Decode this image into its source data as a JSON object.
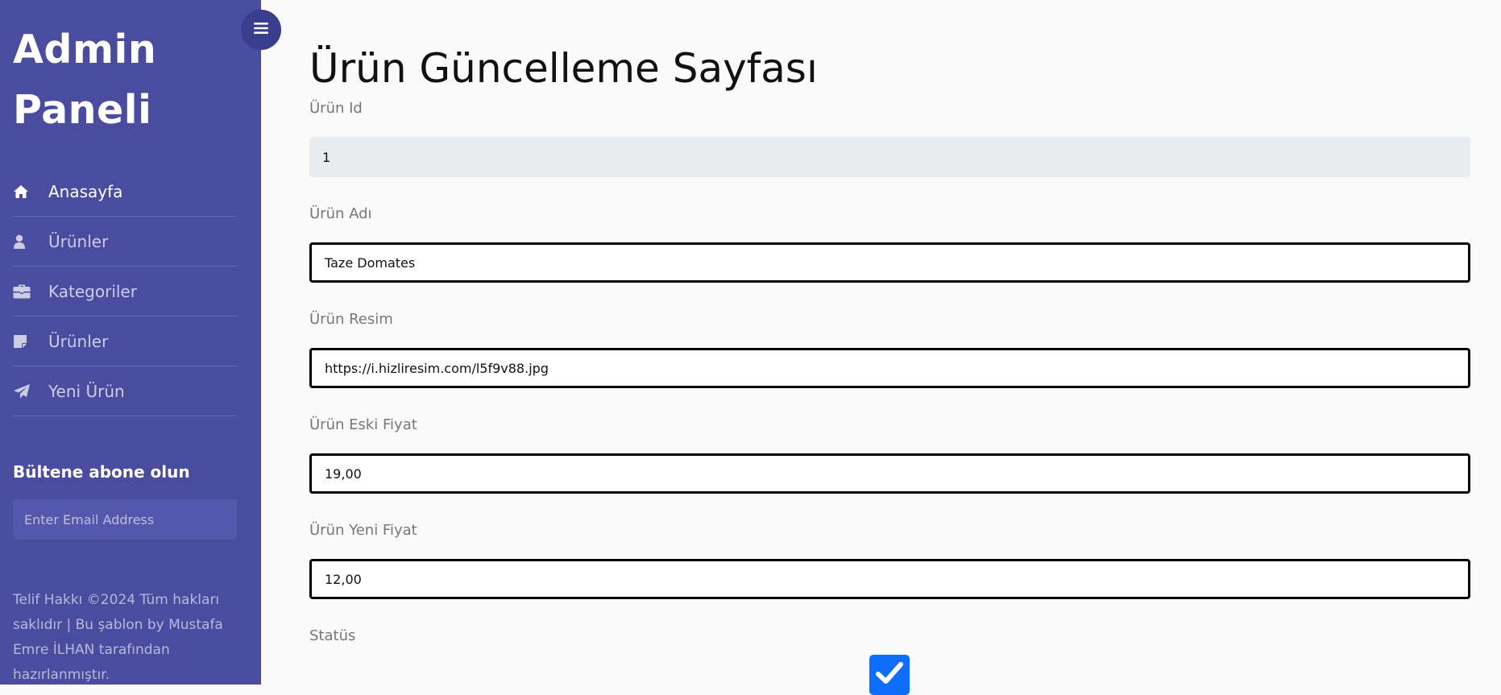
{
  "sidebar": {
    "brand_line1": "Admin",
    "brand_line2": "Paneli",
    "items": [
      {
        "label": "Anasayfa",
        "icon": "home-icon",
        "active": true
      },
      {
        "label": "Ürünler",
        "icon": "user-icon",
        "active": false
      },
      {
        "label": "Kategoriler",
        "icon": "briefcase-icon",
        "active": false
      },
      {
        "label": "Ürünler",
        "icon": "sticky-note-icon",
        "active": false
      },
      {
        "label": "Yeni Ürün",
        "icon": "paper-plane-icon",
        "active": false
      }
    ],
    "newsletter_title": "Bültene abone olun",
    "newsletter_placeholder": "Enter Email Address",
    "copyright": "Telif Hakkı ©2024 Tüm hakları saklıdır | Bu şablon by Mustafa Emre İLHAN tarafından hazırlanmıştır.",
    "toggle_icon": "hamburger-icon"
  },
  "main": {
    "title": "Ürün Güncelleme Sayfası",
    "fields": {
      "id": {
        "label": "Ürün Id",
        "value": "1"
      },
      "name": {
        "label": "Ürün Adı",
        "value": "Taze Domates"
      },
      "image": {
        "label": "Ürün Resim",
        "value": "https://i.hizliresim.com/l5f9v88.jpg"
      },
      "old_price": {
        "label": "Ürün Eski Fiyat",
        "value": "19,00"
      },
      "new_price": {
        "label": "Ürün Yeni Fiyat",
        "value": "12,00"
      },
      "status": {
        "label": "Statüs",
        "checked": true
      }
    }
  },
  "colors": {
    "sidebar_bg": "#4a4ca0",
    "toggle_bg": "#3a3c8c",
    "checkbox_bg": "#0d6efd",
    "page_bg": "#fafafa"
  }
}
